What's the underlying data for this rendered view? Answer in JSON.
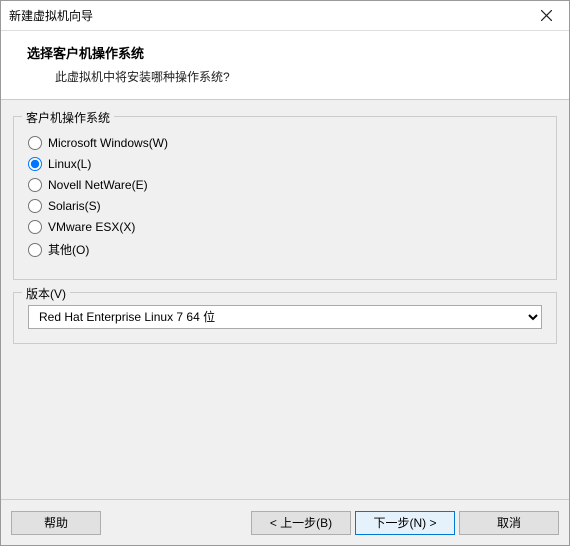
{
  "title": "新建虚拟机向导",
  "header": {
    "title": "选择客户机操作系统",
    "subtitle": "此虚拟机中将安装哪种操作系统?"
  },
  "os_section": {
    "legend": "客户机操作系统",
    "options": [
      {
        "label": "Microsoft Windows(W)",
        "checked": false
      },
      {
        "label": "Linux(L)",
        "checked": true
      },
      {
        "label": "Novell NetWare(E)",
        "checked": false
      },
      {
        "label": "Solaris(S)",
        "checked": false
      },
      {
        "label": "VMware ESX(X)",
        "checked": false
      },
      {
        "label": "其他(O)",
        "checked": false
      }
    ]
  },
  "version_section": {
    "legend": "版本(V)",
    "selected": "Red Hat Enterprise Linux 7 64 位"
  },
  "buttons": {
    "help": "帮助",
    "back": "< 上一步(B)",
    "next": "下一步(N) >",
    "cancel": "取消"
  }
}
